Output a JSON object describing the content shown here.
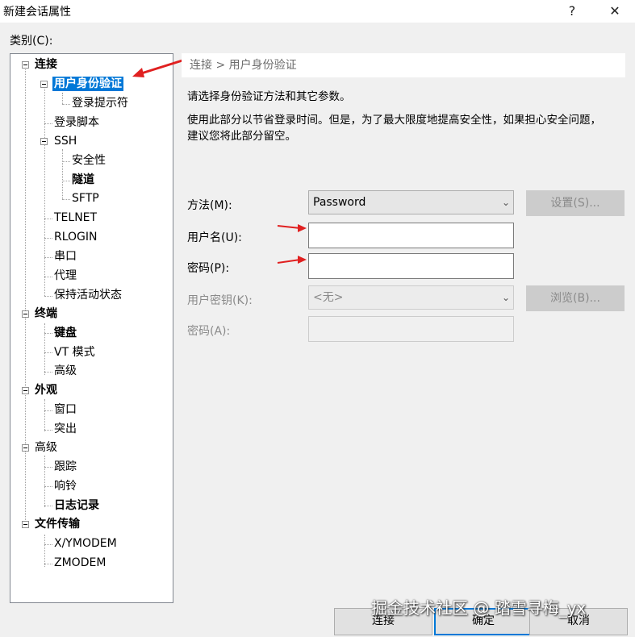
{
  "window": {
    "title": "新建会话属性",
    "help": "?",
    "close": "✕"
  },
  "category_label": "类别(C):",
  "tree": {
    "connection": "连接",
    "auth": "用户身份验证",
    "login_prompt": "登录提示符",
    "login_script": "登录脚本",
    "ssh": "SSH",
    "security": "安全性",
    "tunnel": "隧道",
    "sftp": "SFTP",
    "telnet": "TELNET",
    "rlogin": "RLOGIN",
    "serial": "串口",
    "proxy": "代理",
    "keepalive": "保持活动状态",
    "terminal": "终端",
    "keyboard": "键盘",
    "vt_mode": "VT 模式",
    "advanced": "高级",
    "appearance": "外观",
    "window": "窗口",
    "highlight": "突出",
    "advanced_top": "高级",
    "trace": "跟踪",
    "bell": "响铃",
    "logging": "日志记录",
    "file_transfer": "文件传输",
    "xymodem": "X/YMODEM",
    "zmodem": "ZMODEM"
  },
  "panel": {
    "breadcrumb": "连接 > 用户身份验证",
    "intro": "请选择身份验证方法和其它参数。",
    "note_line1": "使用此部分以节省登录时间。但是，为了最大限度地提高安全性，如果担心安全问题，",
    "note_line2": "建议您将此部分留空。",
    "method_label": "方法(M):",
    "method_value": "Password",
    "settings_btn": "设置(S)...",
    "username_label": "用户名(U):",
    "username_value": "",
    "password_label": "密码(P):",
    "password_value": "",
    "userkey_label": "用户密钥(K):",
    "userkey_value": "<无>",
    "browse_btn": "浏览(B)...",
    "passphrase_label": "密码(A):",
    "passphrase_value": ""
  },
  "buttons": {
    "connect": "连接",
    "ok": "确定",
    "cancel": "取消"
  },
  "watermark": "掘金技术社区 @ 踏雪寻梅_yx",
  "colors": {
    "selection": "#0078d7",
    "arrow": "#e02020"
  }
}
